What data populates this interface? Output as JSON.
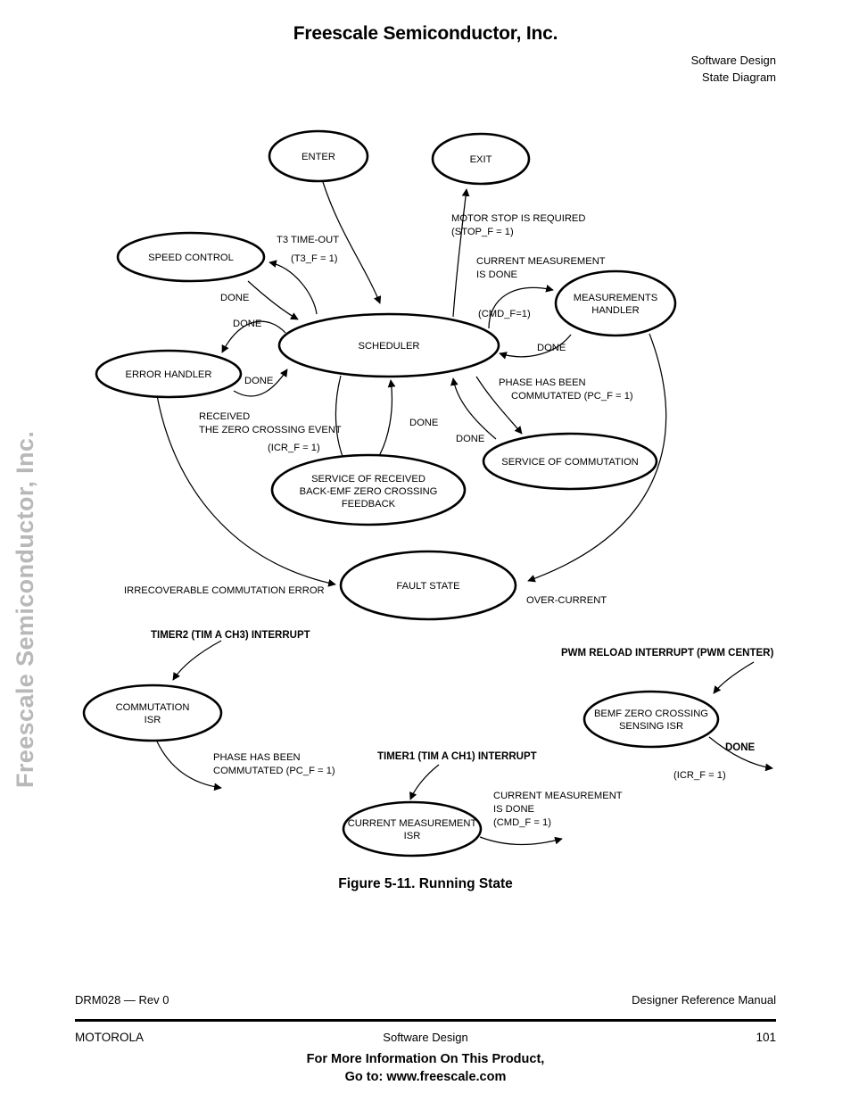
{
  "header": {
    "title": "Freescale Semiconductor, Inc.",
    "right_line1": "Software Design",
    "right_line2": "State Diagram"
  },
  "watermark": {
    "text": "Freescale Semiconductor, Inc.",
    "color": "#b8b8b8"
  },
  "figure": {
    "caption": "Figure 5-11. Running State"
  },
  "diagram": {
    "nodes": {
      "enter": "ENTER",
      "exit": "EXIT",
      "speed_control": "SPEED CONTROL",
      "scheduler": "SCHEDULER",
      "error_handler": "ERROR HANDLER",
      "measurements_handler_l1": "MEASUREMENTS",
      "measurements_handler_l2": "HANDLER",
      "service_commutation": "SERVICE OF COMMUTATION",
      "backemf_l1": "SERVICE OF RECEIVED",
      "backemf_l2": "BACK-EMF ZERO CROSSING",
      "backemf_l3": "FEEDBACK",
      "fault_state": "FAULT STATE",
      "commutation_isr_l1": "COMMUTATION",
      "commutation_isr_l2": "ISR",
      "current_meas_isr_l1": "CURRENT MEASUREMENT",
      "current_meas_isr_l2": "ISR",
      "bemf_isr_l1": "BEMF ZERO CROSSING",
      "bemf_isr_l2": "SENSING ISR"
    },
    "edge_labels": {
      "t3_timeout_l1": "T3 TIME-OUT",
      "t3_timeout_l2": "(T3_F = 1)",
      "motor_stop_l1": "MOTOR STOP IS REQUIRED",
      "motor_stop_l2": "(STOP_F = 1)",
      "curr_meas_done_l1": "CURRENT MEASUREMENT",
      "curr_meas_done_l2": "IS DONE",
      "cmd_f_1": "(CMD_F=1)",
      "done_speed": "DONE",
      "done_error_out": "DONE",
      "done_error_in": "DONE",
      "done_meas": "DONE",
      "done_backemf": "DONE",
      "done_commutation": "DONE",
      "phase_commutated_l1": "PHASE HAS BEEN",
      "phase_commutated_l2": "COMMUTATED (PC_F = 1)",
      "received_zc_l1": "RECEIVED",
      "received_zc_l2": "THE ZERO CROSSING EVENT",
      "received_zc_l3": "(ICR_F = 1)",
      "irrecoverable": "IRRECOVERABLE COMMUTATION ERROR",
      "over_current": "OVER-CURRENT",
      "timer2_interrupt": "TIMER2 (TIM A CH3) INTERRUPT",
      "timer1_interrupt": "TIMER1 (TIM A CH1) INTERRUPT",
      "pwm_reload_interrupt": "PWM RELOAD INTERRUPT (PWM CENTER)",
      "isr_phase_commutated_l1": "PHASE HAS BEEN",
      "isr_phase_commutated_l2": "COMMUTATED (PC_F = 1)",
      "isr_curr_meas_l1": "CURRENT MEASUREMENT",
      "isr_curr_meas_l2": "IS DONE",
      "isr_curr_meas_l3": "(CMD_F = 1)",
      "isr_done": "DONE",
      "isr_icr_f": "(ICR_F = 1)"
    }
  },
  "footer": {
    "doc_id": "DRM028 — Rev 0",
    "manual": "Designer Reference Manual",
    "company": "MOTOROLA",
    "section": "Software Design",
    "page_number": "101",
    "promo_line1": "For More Information On This Product,",
    "promo_line2": "Go to: www.freescale.com"
  }
}
